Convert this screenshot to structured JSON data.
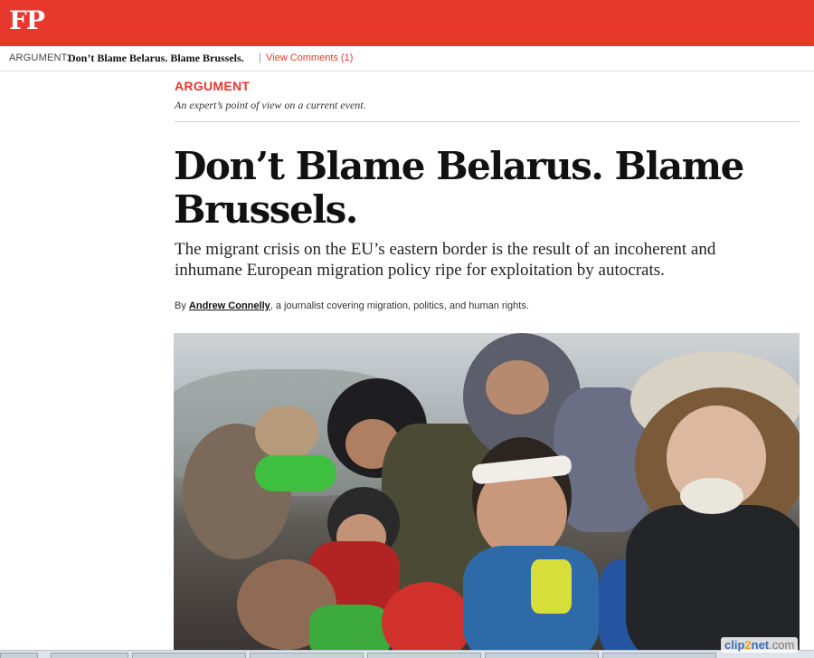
{
  "brand": {
    "logo": "FP"
  },
  "strip": {
    "kicker": "ARGUMENT:",
    "title": "Don’t Blame Belarus. Blame Brussels.",
    "separator": "|",
    "comments_link": "View Comments (1)"
  },
  "article": {
    "kicker": "ARGUMENT",
    "kicker_description": "An expert’s point of view on a current event.",
    "headline": "Don’t Blame Belarus. Blame Brussels.",
    "dek": "The migrant crisis on the EU’s eastern border is the result of an incoherent and inhumane European migration policy ripe for exploitation by autocrats.",
    "byline": {
      "prefix": "By ",
      "author": "Andrew Connelly",
      "suffix": ", a journalist covering migration, politics, and human rights."
    }
  },
  "watermark": {
    "part1": "clip",
    "part2": "2",
    "part3": "net",
    "suffix": ".com"
  },
  "colors": {
    "brand_red": "#e8382e",
    "text": "#111111"
  }
}
